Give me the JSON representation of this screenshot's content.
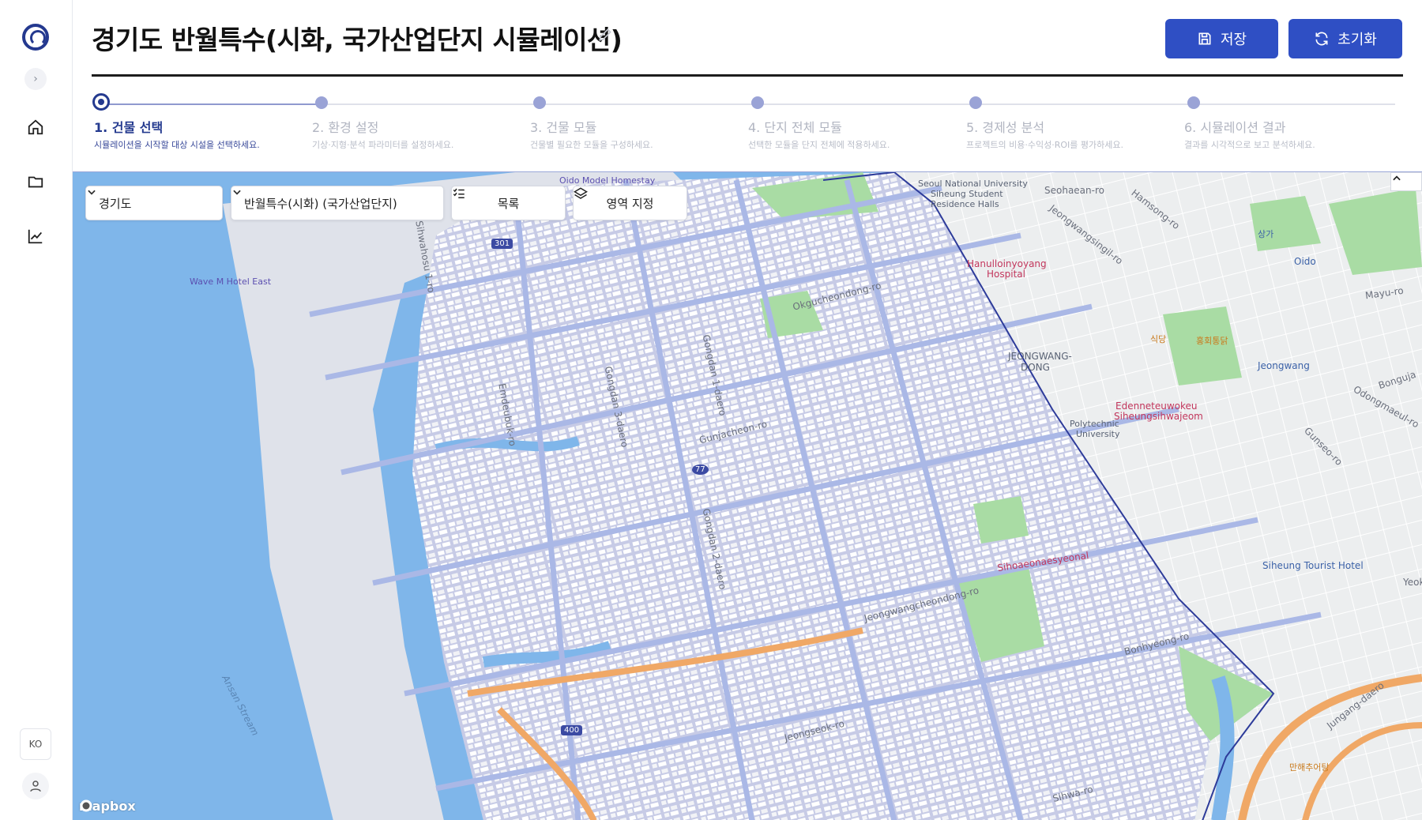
{
  "header": {
    "title": "경기도 반월특수(시화, 국가산업단지 시뮬레이션)",
    "save_label": "저장",
    "reset_label": "초기화"
  },
  "sidebar": {
    "lang": "KO"
  },
  "steps": [
    {
      "title": "1. 건물 선택",
      "desc": "시뮬레이션을 시작할 대상 시설을 선택하세요."
    },
    {
      "title": "2. 환경 설정",
      "desc": "기상·지형·분석 파라미터를 설정하세요."
    },
    {
      "title": "3. 건물 모듈",
      "desc": "건물별 필요한 모듈을 구성하세요."
    },
    {
      "title": "4. 단지 전체 모듈",
      "desc": "선택한 모듈을 단지 전체에 적용하세요."
    },
    {
      "title": "5. 경제성 분석",
      "desc": "프로젝트의 비용·수익성·ROI를 평가하세요."
    },
    {
      "title": "6. 시뮬레이션 결과",
      "desc": "결과를 시각적으로 보고 분석하세요."
    }
  ],
  "map_controls": {
    "province": "경기도",
    "complex": "반월특수(시화) (국가산업단지)",
    "list_label": "목록",
    "area_label": "영역 지정"
  },
  "map_labels": {
    "wave_hotel": "Wave M Hotel East",
    "oido_homestay": "Oido Model Homestay",
    "snu_1": "Seoul National University",
    "snu_2": "Siheung Student",
    "snu_3": "Residence Halls",
    "seohaean": "Seohaean-ro",
    "hamsong": "Hamsong-ro",
    "jeongwangsingil": "Jeongwangsingil-ro",
    "hospital_1": "Hanulloinyoyang",
    "hospital_2": "Hospital",
    "oido": "Oido",
    "mayu": "Mayu-ro",
    "jeongwang_dong_1": "JEONGWANG-",
    "jeongwang_dong_2": "DONG",
    "jeongwang": "Jeongwang",
    "edenne_1": "Edenneteuwokeu",
    "edenne_2": "Siheungsihwajeom",
    "bonguja": "Bonguja",
    "odongmaeul": "Odongmaeul-ro",
    "gunseo": "Gunseo-ro",
    "tourist_hotel": "Siheung Tourist Hotel",
    "yeok": "Yeok",
    "ansan_stream": "Ansan Stream",
    "gunjacheon": "Gunjacheon-ro",
    "okgucheondong": "Okgucheondong-ro",
    "jeongwangcheondong": "Jeongwangcheondong-ro",
    "jungang": "Jungang-daero",
    "siheung_tourist": "Sihwa-ro",
    "gongdan1": "Gongdan 1-daero",
    "gongdan2": "Gongdan 2-daero",
    "gongdan3": "Gongdan 3-daero",
    "sihwahosu": "Sihwahosu 1-ro",
    "emdeubuk": "Emdeubuk-ro",
    "politech_1": "Polytechnic",
    "politech_2": "University",
    "siheung_ind": "Sihoaeonaesyeonal",
    "bonhyeong": "Bonhyeong-ro",
    "jeongseok": "Jeongseok-ro",
    "shield_301": "301",
    "shield_77": "77",
    "shield_400": "400",
    "sangga": "상가",
    "sikdang": "식당",
    "honghoe": "홍회통닭",
    "manhae": "만해추어탕",
    "mapbox": "mapbox"
  },
  "colors": {
    "accent": "#2f4fc4",
    "step_active": "#243a8f",
    "water": "#7fb6ea",
    "industrial_zone": "#c9cde8",
    "land": "#eef0f1",
    "park": "#a9dca4"
  }
}
